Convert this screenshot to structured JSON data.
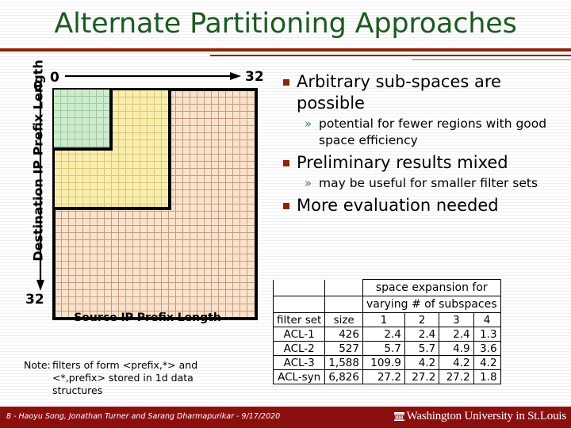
{
  "slide": {
    "title": "Alternate Partitioning Approaches",
    "accent_dark_red": "#8c2407",
    "title_green": "#1d5a22",
    "footer_red": "#8c0f0f"
  },
  "diagram": {
    "x_axis_label": "Source IP Prefix Length",
    "y_axis_label": "Destination IP Prefix Length",
    "x_min_label": "0",
    "x_max_label": "32",
    "y_min_label": "0",
    "y_max_label": "32",
    "regions": [
      {
        "name": "green-subspace",
        "color": "#cdeccd"
      },
      {
        "name": "yellow-subspace",
        "color": "#f9eeae"
      },
      {
        "name": "peach-subspace",
        "color": "#fae3cd"
      }
    ],
    "note_label": "Note:",
    "note_text": "filters of form <prefix,*> and <*,prefix> stored in 1d data structures"
  },
  "bullets": [
    {
      "level": 1,
      "text": "Arbitrary sub-spaces are possible"
    },
    {
      "level": 2,
      "text": "potential for fewer regions with good space efficiency"
    },
    {
      "level": 1,
      "text": "Preliminary results mixed"
    },
    {
      "level": 2,
      "text": "may be useful for smaller filter sets"
    },
    {
      "level": 1,
      "text": "More evaluation needed"
    }
  ],
  "table": {
    "group_header_line1": "space expansion for",
    "group_header_line2": "varying # of subspaces",
    "col_filter_set": "filter set",
    "col_size": "size",
    "subspace_columns": [
      "1",
      "2",
      "3",
      "4"
    ],
    "rows": [
      {
        "filter_set": "ACL-1",
        "size": "426",
        "values": [
          "2.4",
          "2.4",
          "2.4",
          "1.3"
        ]
      },
      {
        "filter_set": "ACL-2",
        "size": "527",
        "values": [
          "5.7",
          "5.7",
          "4.9",
          "3.6"
        ]
      },
      {
        "filter_set": "ACL-3",
        "size": "1,588",
        "values": [
          "109.9",
          "4.2",
          "4.2",
          "4.2"
        ]
      },
      {
        "filter_set": "ACL-syn",
        "size": "6,826",
        "values": [
          "27.2",
          "27.2",
          "27.2",
          "1.8"
        ]
      }
    ]
  },
  "footer": {
    "credit": "8 - Haoyu Song, Jonathan Turner and Sarang Dharmapurikar - 9/17/2020",
    "university": "Washington University in St.Louis"
  }
}
